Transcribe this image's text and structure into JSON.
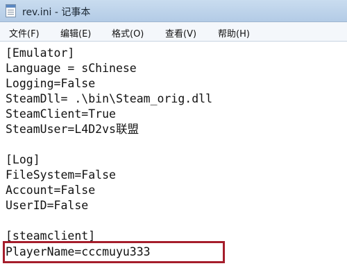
{
  "window": {
    "title": "rev.ini - 记事本",
    "icon": "notepad-icon"
  },
  "menu": {
    "items": [
      {
        "label": "文件(F)"
      },
      {
        "label": "编辑(E)"
      },
      {
        "label": "格式(O)"
      },
      {
        "label": "查看(V)"
      },
      {
        "label": "帮助(H)"
      }
    ]
  },
  "editor": {
    "lines": [
      "[Emulator]",
      "Language = sChinese",
      "Logging=False",
      "SteamDll= .\\bin\\Steam_orig.dll",
      "SteamClient=True",
      "SteamUser=L4D2vs联盟",
      "",
      "[Log]",
      "FileSystem=False",
      "Account=False",
      "UserID=False",
      "",
      "[steamclient]",
      "PlayerName=cccmuyu333"
    ]
  },
  "annotation": {
    "highlight_color": "#a51d2b"
  }
}
